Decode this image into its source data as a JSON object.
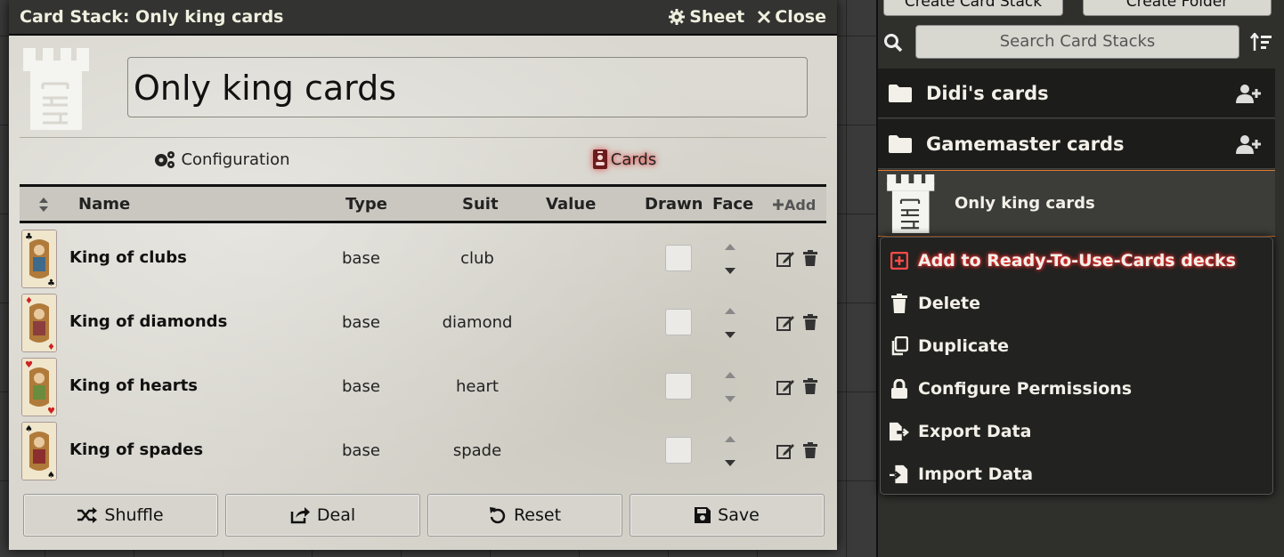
{
  "window": {
    "title": "Card Stack: Only king cards",
    "sheet_label": "Sheet",
    "close_label": "Close"
  },
  "stack": {
    "name": "Only king cards"
  },
  "tabs": [
    {
      "label": "Configuration",
      "active": false,
      "icon": "gears-icon"
    },
    {
      "label": "Cards",
      "active": true,
      "icon": "id-badge-icon"
    }
  ],
  "table": {
    "headers": {
      "name": "Name",
      "type": "Type",
      "suit": "Suit",
      "value": "Value",
      "drawn": "Drawn",
      "face": "Face",
      "add": "Add"
    },
    "rows": [
      {
        "name": "King of clubs",
        "type": "base",
        "suit": "club",
        "value": "",
        "drawn": false
      },
      {
        "name": "King of diamonds",
        "type": "base",
        "suit": "diamond",
        "value": "",
        "drawn": false
      },
      {
        "name": "King of hearts",
        "type": "base",
        "suit": "heart",
        "value": "",
        "drawn": false
      },
      {
        "name": "King of spades",
        "type": "base",
        "suit": "spade",
        "value": "",
        "drawn": false
      }
    ]
  },
  "footer": {
    "shuffle": "Shuffle",
    "deal": "Deal",
    "reset": "Reset",
    "save": "Save"
  },
  "sidebar": {
    "create_stack": "Create Card Stack",
    "create_folder": "Create Folder",
    "search_placeholder": "Search Card Stacks",
    "folders": [
      {
        "name": "Didi's cards"
      },
      {
        "name": "Gamemaster cards"
      }
    ],
    "entry": {
      "name": "Only king cards"
    },
    "context_menu": [
      {
        "label": "Add to Ready-To-Use-Cards decks",
        "icon": "plus-square-icon",
        "highlighted": true
      },
      {
        "label": "Delete",
        "icon": "trash-icon"
      },
      {
        "label": "Duplicate",
        "icon": "copy-icon"
      },
      {
        "label": "Configure Permissions",
        "icon": "lock-icon"
      },
      {
        "label": "Export Data",
        "icon": "file-export-icon"
      },
      {
        "label": "Import Data",
        "icon": "file-import-icon"
      }
    ]
  },
  "colors": {
    "accent_border": "#e07b2e",
    "highlight_glow": "#ff3030",
    "header_bg": "#333331"
  }
}
